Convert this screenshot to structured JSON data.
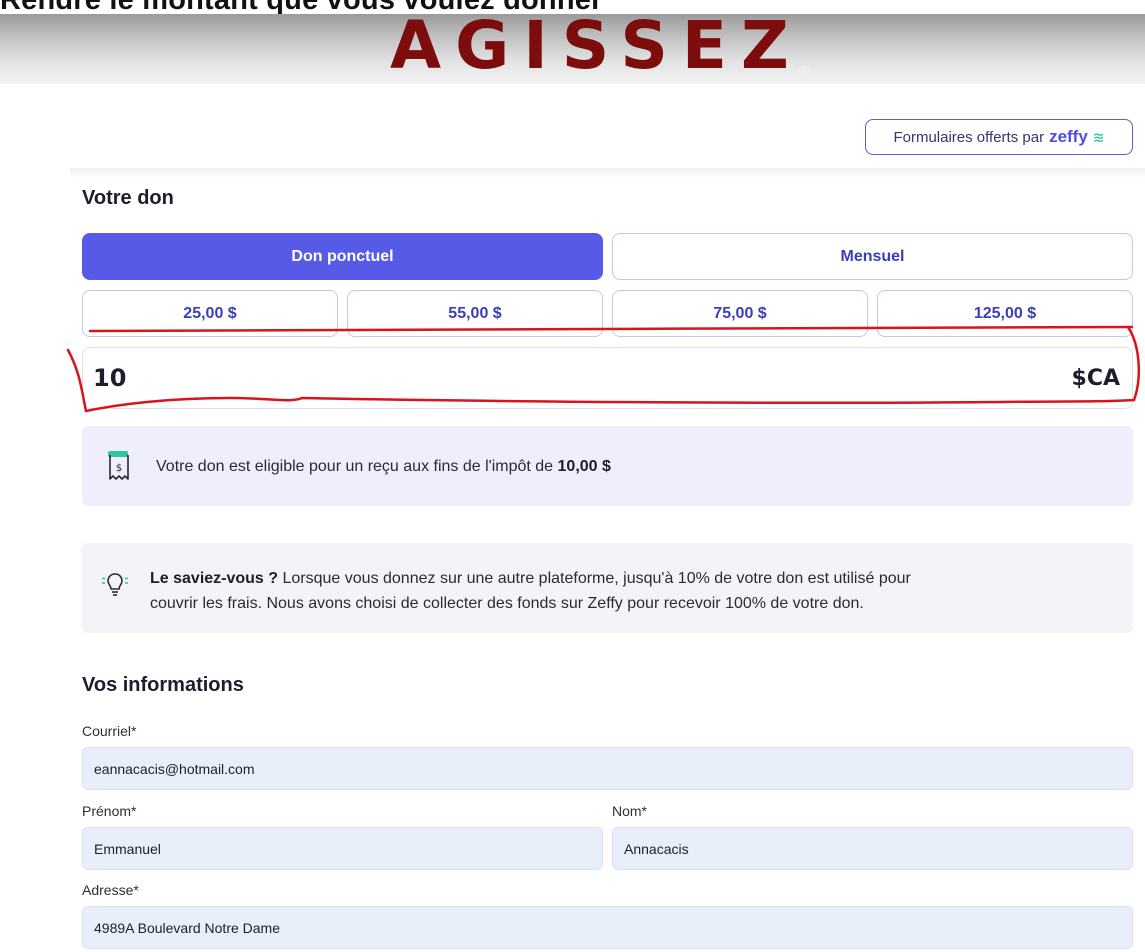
{
  "banner": {
    "top_text": "Rendre le montant que vous voulez donner",
    "word": "AGISSEZ"
  },
  "zeffy": {
    "prefix": "Formulaires offerts par",
    "brand": "zeffy"
  },
  "donation": {
    "title": "Votre don",
    "tabs": [
      {
        "label": "Don ponctuel",
        "active": true
      },
      {
        "label": "Mensuel",
        "active": false
      }
    ],
    "amounts": [
      "25,00 $",
      "55,00 $",
      "75,00 $",
      "125,00 $"
    ],
    "custom_amount": "10",
    "currency": "$CA"
  },
  "receipt": {
    "text": "Votre don est eligible pour un reçu aux fins de l'impôt de",
    "amount": "10,00 $"
  },
  "tip": {
    "bold": "Le saviez-vous ?",
    "line1": "Lorsque vous donnez sur une autre plateforme, jusqu'à 10% de votre don est utilisé pour",
    "line2": "couvrir les frais. Nous avons choisi de collecter des fonds sur Zeffy pour recevoir 100% de votre don."
  },
  "info": {
    "title": "Vos informations",
    "email": {
      "label": "Courriel*",
      "value": "eannacacis@hotmail.com"
    },
    "first_name": {
      "label": "Prénom*",
      "value": "Emmanuel"
    },
    "last_name": {
      "label": "Nom*",
      "value": "Annacacis"
    },
    "address": {
      "label": "Adresse*",
      "value": "4989A Boulevard Notre Dame"
    }
  },
  "colors": {
    "primary": "#575ae6",
    "banner_word": "#7d0c0c",
    "annotation": "#d8141c"
  }
}
